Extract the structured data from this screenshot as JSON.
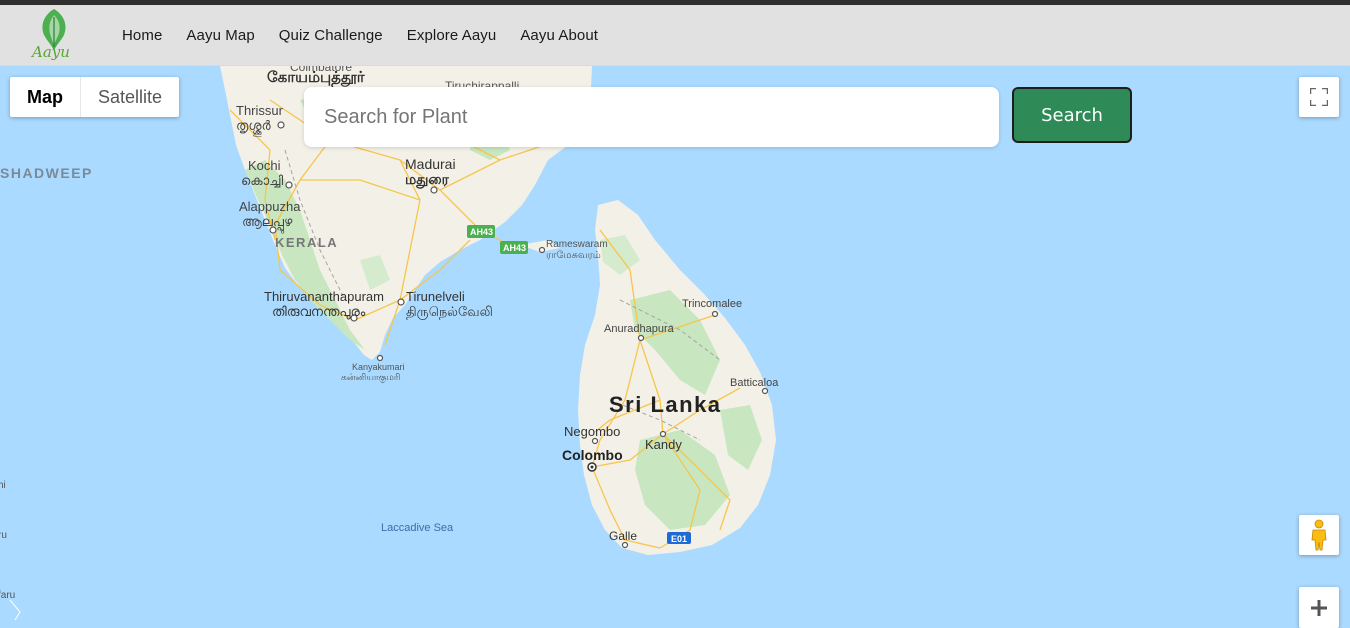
{
  "nav": {
    "logo_text": "Aayu",
    "links": [
      "Home",
      "Aayu Map",
      "Quiz Challenge",
      "Explore Aayu",
      "Aayu About"
    ]
  },
  "map_controls": {
    "map_label": "Map",
    "satellite_label": "Satellite"
  },
  "search": {
    "placeholder": "Search for Plant",
    "button_label": "Search"
  },
  "map_labels": {
    "coimbatore_en": "Coimbatore",
    "coimbatore_ta": "கோயம்புத்தூர்",
    "tiruchirappalli": "Tiruchirappalli",
    "thrissur_en": "Thrissur",
    "thrissur_ml": "തൃശ്ശൂർ",
    "lakshadweep": "SHADWEEP",
    "kochi_en": "Kochi",
    "kochi_ml": "കൊച്ചി",
    "madurai_en": "Madurai",
    "madurai_ta": "மதுரை",
    "alappuzha_en": "Alappuzha",
    "alappuzha_ml": "ആലപ്പുഴ",
    "kerala": "KERALA",
    "ah43a": "AH43",
    "ah43b": "AH43",
    "rameswaram_en": "Rameswaram",
    "rameswaram_ta": "ராமேசுவரம்",
    "thiruvananthapuram_en": "Thiruvananthapuram",
    "thiruvananthapuram_ml": "തിരുവനന്തപുരം",
    "tirunelveli_en": "Tirunelveli",
    "tirunelveli_ta": "திருநெல்வேலி",
    "trincomalee": "Trincomalee",
    "anuradhapura": "Anuradhapura",
    "kanyakumari_en": "Kanyakumari",
    "kanyakumari_ta": "கன்னியாகுமரி",
    "batticaloa": "Batticaloa",
    "sri_lanka": "Sri Lanka",
    "negombo": "Negombo",
    "kandy": "Kandy",
    "colombo": "Colombo",
    "laccadive_sea": "Laccadive Sea",
    "galle": "Galle",
    "e01": "E01",
    "left_edge_1": "hi",
    "left_edge_2": "ru",
    "left_edge_3": "faru"
  },
  "icons": {
    "logo": "leaf-pin-icon",
    "fullscreen": "fullscreen-icon",
    "pegman": "pegman-icon",
    "zoom_in": "plus-icon"
  },
  "colors": {
    "navbar_bg": "#e2e1e1",
    "water": "#aadaff",
    "land": "#f3f1e7",
    "forest": "#c8e6c0",
    "search_button": "#2e8b57",
    "road_yellow": "#f7c54c",
    "highway_green": "#4caf50",
    "highway_blue": "#1e6bd6"
  }
}
